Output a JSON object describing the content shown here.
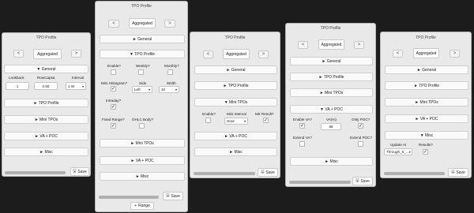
{
  "panels": [
    {
      "title": "TPO Profile",
      "nav_prev": "<",
      "nav_next": ">",
      "mode": "Aggregated",
      "sections": {
        "general": "▼ General",
        "tpo_profile": "► TPO Profile",
        "mini_tpos": "► Mini TPOs",
        "va_poc": "► VA + POC",
        "misc": "► Misc"
      },
      "fields": {
        "lookback_label": "Lookback",
        "lookback_value": "1",
        "rowcapsa_label": "RowCapsa",
        "rowcapsa_value": "0.50",
        "interval_label": "Interval",
        "interval_value": "1 W"
      },
      "save_label": "Save"
    },
    {
      "title": "TPO Profile",
      "nav_prev": "<",
      "nav_next": ">",
      "mode": "Aggregated",
      "sections": {
        "general": "► General",
        "tpo_profile": "▼ TPO Profile",
        "mini_tpos": "► Mini TPOs",
        "va_poc": "► VA + POC",
        "misc": "► Misc"
      },
      "fields": {
        "enable_label": "Enable?",
        "weekly_label": "Weekly?",
        "monthly_label": "Monthly?",
        "histogram_label": "Mini Histogram?",
        "histogram_checked": "✓",
        "side_label": "Side",
        "side_value": "Left",
        "width_label": "Width",
        "width_value": "10",
        "intraday_label": "Intraday?",
        "intraday_checked": "✓",
        "fixed_label": "Fixed Range?",
        "fixed_checked": "✓",
        "ohlc_label": "OHLC Body?"
      },
      "save_label": "Save",
      "range_label": "Range"
    },
    {
      "title": "TPO Profile",
      "nav_prev": "<",
      "nav_next": ">",
      "mode": "Aggregated",
      "sections": {
        "general": "► General",
        "tpo_profile": "► TPO Profile",
        "mini_tpos": "▼ Mini TPOs",
        "va_poc": "► VA + POC",
        "misc": "► Misc"
      },
      "fields": {
        "enable_label": "Enable?",
        "interval_label": "Mini Interval",
        "interval_value": "Hour",
        "mtr_label": "Mtr Result?",
        "mtr_checked": "✓"
      },
      "save_label": "Save"
    },
    {
      "title": "TPO Profile",
      "nav_prev": "<",
      "nav_next": ">",
      "mode": "Aggregated",
      "sections": {
        "general": "► General",
        "tpo_profile": "► TPO Profile",
        "mini_tpos": "► Mini TPOs",
        "va_poc": "▼ VA + POC",
        "misc": "► Misc"
      },
      "fields": {
        "enable_label": "Enable VA?",
        "enable_checked": "✓",
        "va_label": "VA(%)",
        "va_value": "68",
        "only_label": "Only POC?",
        "only_checked": "✓",
        "extend_va_label": "Extend VA?",
        "extend_poc_label": "Extend POC?"
      },
      "save_label": "Save"
    },
    {
      "title": "TPO Profile",
      "nav_prev": "<",
      "nav_next": ">",
      "mode": "Aggregated",
      "sections": {
        "general": "► General",
        "tpo_profile": "► TPO Profile",
        "mini_tpos": "► Mini TPOs",
        "va_poc": "► VA + POC",
        "misc": "▼ Misc"
      },
      "fields": {
        "update_label": "Update At",
        "update_value": "Through_5_...",
        "results_label": "Results?",
        "results_checked": "✓"
      },
      "save_label": "Save"
    }
  ]
}
